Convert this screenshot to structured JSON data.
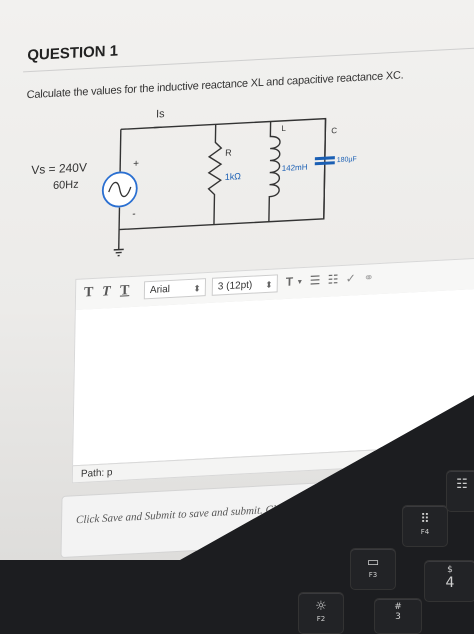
{
  "question": {
    "title": "QUESTION 1",
    "prompt": "Calculate the values for the inductive reactance XL and capacitive reactance XC."
  },
  "circuit": {
    "current_label": "Is",
    "source_voltage": "Vs = 240V",
    "source_freq": "60Hz",
    "plus": "+",
    "minus": "-",
    "resistor_label": "R",
    "resistor_value": "1kΩ",
    "inductor_label": "L",
    "inductor_value": "142mH",
    "capacitor_label": "C",
    "capacitor_value": "180µF"
  },
  "toolbar": {
    "format_t1": "T",
    "format_t2": "T",
    "format_t3": "T",
    "font_family": "Arial",
    "font_size": "3 (12pt)",
    "text_color": "T",
    "list_ul": "☰",
    "list_ol": "☷"
  },
  "editor": {
    "path_label": "Path: p"
  },
  "footer": {
    "instructions": "Click Save and Submit to save and submit. Click Save All Answers to save all answers."
  },
  "keyboard": {
    "f2_label": "F2",
    "f3_label": "F3",
    "f4_label": "F4",
    "key_3": "3",
    "key_4": "4",
    "hash": "#",
    "dollar": "$"
  }
}
